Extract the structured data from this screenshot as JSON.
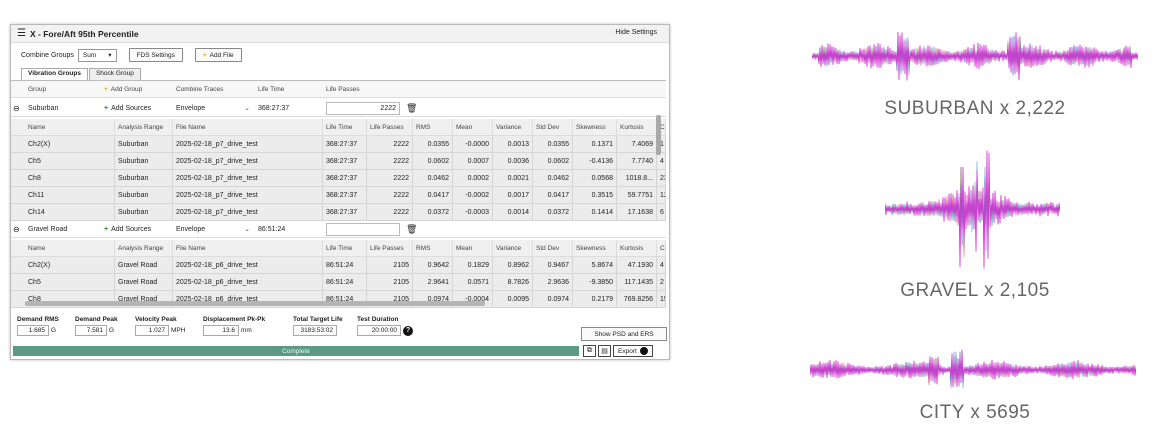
{
  "window": {
    "title": "X - Fore/Aft 95th Percentile",
    "hide_settings": "Hide Settings",
    "combine_groups_label": "Combine Groups",
    "combine_groups_value": "Sum",
    "fds_settings": "FDS Settings",
    "add_file": "Add File"
  },
  "tabs": [
    "Vibration Groups",
    "Shock Group"
  ],
  "group_header": {
    "group": "Group",
    "add_group": "Add Group",
    "combine_traces": "Combine Traces",
    "life_time": "Life Time",
    "life_passes": "Life Passes"
  },
  "columns": [
    "Name",
    "Analysis Range",
    "File Name",
    "Life Time",
    "Life Passes",
    "RMS",
    "Mean",
    "Variance",
    "Std Dev",
    "Skewness",
    "Kurtosis",
    "Cr"
  ],
  "groups": [
    {
      "name": "Suburban",
      "add_sources": "Add Sources",
      "combine": "Envelope",
      "life_time": "368:27:37",
      "life_passes": "2222",
      "rows": [
        [
          "Ch2(X)",
          "Suburban",
          "2025-02-18_p7_drive_test",
          "368:27:37",
          "2222",
          "0.0355",
          "-0.0000",
          "0.0013",
          "0.0355",
          "0.1371",
          "7.4069",
          "1"
        ],
        [
          "Ch5",
          "Suburban",
          "2025-02-18_p7_drive_test",
          "368:27:37",
          "2222",
          "0.0602",
          "0.0007",
          "0.0036",
          "0.0602",
          "-0.4136",
          "7.7740",
          "4"
        ],
        [
          "Ch8",
          "Suburban",
          "2025-02-18_p7_drive_test",
          "368:27:37",
          "2222",
          "0.0462",
          "0.0002",
          "0.0021",
          "0.0462",
          "0.0568",
          "1018.8...",
          "23"
        ],
        [
          "Ch11",
          "Suburban",
          "2025-02-18_p7_drive_test",
          "368:27:37",
          "2222",
          "0.0417",
          "-0.0002",
          "0.0017",
          "0.0417",
          "0.3515",
          "59.7751",
          "12"
        ],
        [
          "Ch14",
          "Suburban",
          "2025-02-18_p7_drive_test",
          "368:27:37",
          "2222",
          "0.0372",
          "-0.0003",
          "0.0014",
          "0.0372",
          "0.1414",
          "17.1638",
          "6"
        ]
      ]
    },
    {
      "name": "Gravel Road",
      "add_sources": "Add Sources",
      "combine": "Envelope",
      "life_time": "86:51:24",
      "life_passes": "",
      "rows": [
        [
          "Ch2(X)",
          "Gravel Road",
          "2025-02-18_p6_drive_test",
          "86:51:24",
          "2105",
          "0.9642",
          "0.1829",
          "0.8962",
          "0.9467",
          "5.8674",
          "47.1930",
          "4"
        ],
        [
          "Ch5",
          "Gravel Road",
          "2025-02-18_p6_drive_test",
          "86:51:24",
          "2105",
          "2.9641",
          "0.0571",
          "8.7826",
          "2.9636",
          "-9.3850",
          "117.1435",
          "2"
        ],
        [
          "Ch8",
          "Gravel Road",
          "2025-02-18_p6_drive_test",
          "86:51:24",
          "2105",
          "0.0974",
          "-0.0004",
          "0.0095",
          "0.0974",
          "0.2179",
          "769.8256",
          "15"
        ]
      ]
    }
  ],
  "metrics": [
    {
      "label": "Demand RMS",
      "value": "1.685",
      "unit": "G"
    },
    {
      "label": "Demand Peak",
      "value": "7.581",
      "unit": "G"
    },
    {
      "label": "Velocity Peak",
      "value": "1.027",
      "unit": "MPH"
    },
    {
      "label": "Displacement Pk-Pk",
      "value": "13.6",
      "unit": "mm"
    },
    {
      "label": "Total Target Life",
      "value": "3183:53:02",
      "unit": ""
    },
    {
      "label": "Test Duration",
      "value": "20:00:00",
      "unit": ""
    }
  ],
  "show_psd": "Show PSD and ERS",
  "progress": {
    "label": "Complete",
    "fraction": 1.0
  },
  "export": "Export",
  "waveforms": [
    {
      "label": "SUBURBAN x 2,222"
    },
    {
      "label": "GRAVEL x 2,105"
    },
    {
      "label": "CITY x 5695"
    }
  ],
  "colors": {
    "progress": "#5d9a86",
    "wave_main": "#d63ad6",
    "wave_alt1": "#7a2fb0",
    "wave_alt2": "#e03030",
    "wave_alt3": "#2e9e4a",
    "wave_alt4": "#2a6fd1"
  }
}
